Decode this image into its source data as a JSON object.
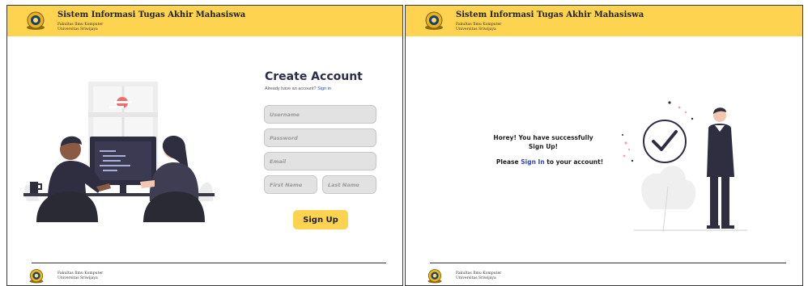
{
  "header": {
    "title": "Sistem Informasi Tugas Akhir Mahasiswa",
    "faculty": "Fakultas Ilmu Komputer",
    "university": "Universitas Sriwijaya"
  },
  "footer": {
    "faculty": "Fakultas Ilmu Komputer",
    "university": "Universitas Sriwijaya"
  },
  "signup_form": {
    "title": "Create Account",
    "have_account_text": "Already have an account?",
    "signin_link": "Sign in",
    "username_placeholder": "Username",
    "password_placeholder": "Password",
    "email_placeholder": "Email",
    "first_name_placeholder": "First Name",
    "last_name_placeholder": "Last Name",
    "submit_label": "Sign Up"
  },
  "success": {
    "line1": "Horey! You have successfully",
    "line2": "Sign Up!",
    "please_prefix": "Please",
    "signin_link": "Sign In",
    "please_suffix": "to your account!"
  },
  "colors": {
    "header_bg": "#fdd34f",
    "link": "#2d45c4",
    "input_bg": "#e2e2e2",
    "title": "#2a2e4a"
  }
}
